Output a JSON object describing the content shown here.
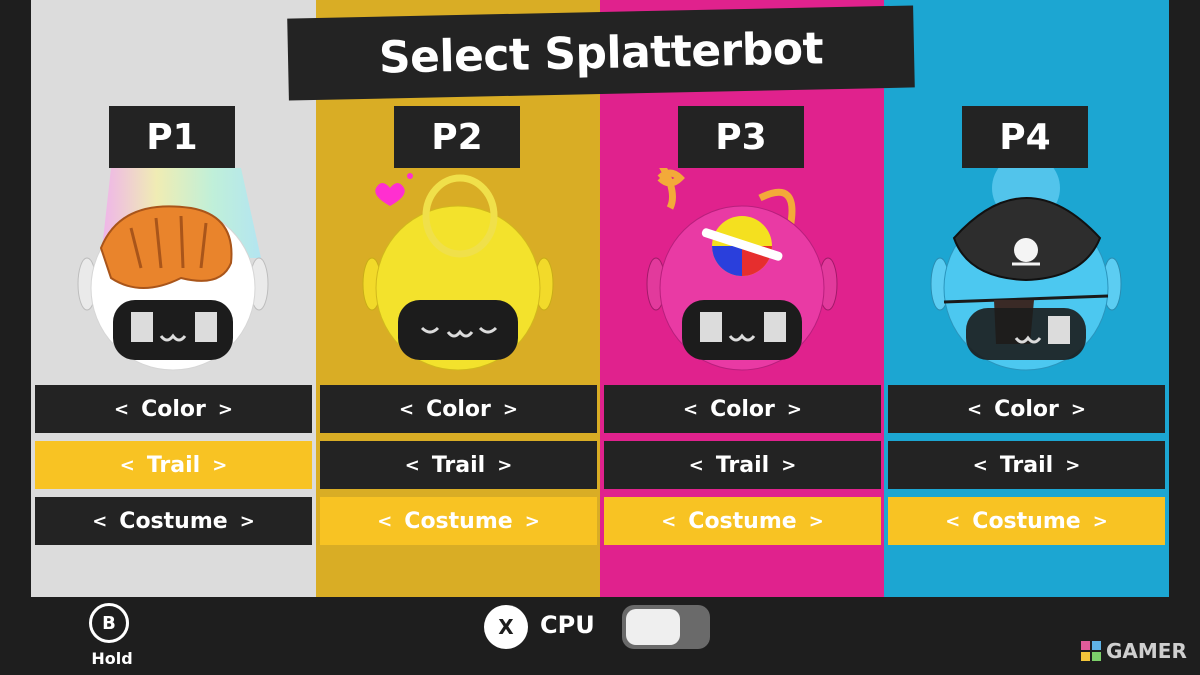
{
  "title": "Select Splatterbot",
  "players": [
    {
      "label": "P1",
      "panel_color": "#dcdcdc",
      "bot_color": "#ffffff",
      "accessory": "orange-cat",
      "trail": "rainbow",
      "options": {
        "color": "Color",
        "trail": "Trail",
        "costume": "Costume"
      },
      "selected": "trail"
    },
    {
      "label": "P2",
      "panel_color": "#d9ad25",
      "bot_color": "#f3e22c",
      "accessory": "halo",
      "trail": "hearts",
      "options": {
        "color": "Color",
        "trail": "Trail",
        "costume": "Costume"
      },
      "selected": "costume"
    },
    {
      "label": "P3",
      "panel_color": "#e0228d",
      "bot_color": "#e93aa4",
      "accessory": "propeller-ball",
      "trail": "music-notes",
      "options": {
        "color": "Color",
        "trail": "Trail",
        "costume": "Costume"
      },
      "selected": "costume"
    },
    {
      "label": "P4",
      "panel_color": "#1ca6d2",
      "bot_color": "#4cc8f0",
      "accessory": "pirate-hat",
      "trail": "bubbles",
      "options": {
        "color": "Color",
        "trail": "Trail",
        "costume": "Costume"
      },
      "selected": "costume"
    }
  ],
  "arrows": {
    "left": "<",
    "right": ">"
  },
  "bottom_bar": {
    "back_button": "B",
    "back_label": "Hold",
    "cpu_button": "X",
    "cpu_label": "CPU",
    "cpu_toggle": "off"
  },
  "watermark": {
    "text": "GAMER"
  },
  "colors": {
    "selected_option": "#f8c323",
    "dark": "#232323",
    "background": "#1e1e1e"
  }
}
